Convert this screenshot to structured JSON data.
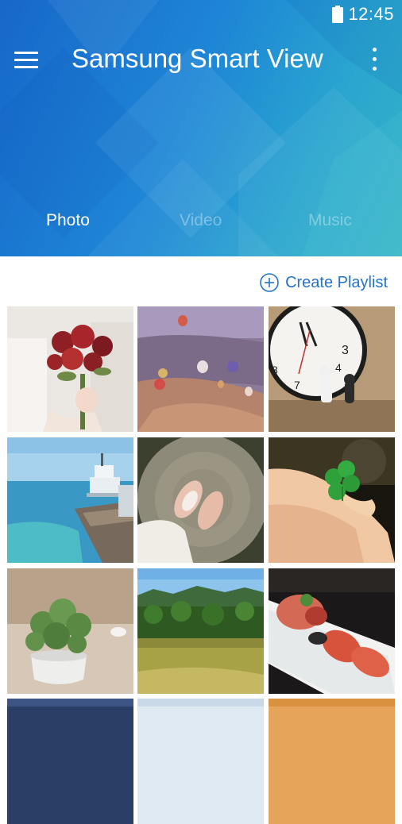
{
  "status_bar": {
    "time": "12:45",
    "battery_icon": "battery-icon"
  },
  "header": {
    "title": "Samsung Smart View",
    "menu_icon": "hamburger-menu-icon",
    "more_icon": "more-vert-icon"
  },
  "tabs": [
    {
      "label": "Photo",
      "selected": true
    },
    {
      "label": "Video",
      "selected": false
    },
    {
      "label": "Music",
      "selected": false
    }
  ],
  "actions": {
    "create_playlist": "Create Playlist",
    "icon": "add-circle-icon"
  },
  "colors": {
    "header_start": "#1767c9",
    "header_end": "#35b3c6",
    "accent": "#2573c9"
  },
  "photos": [
    "photo-red-roses-bouquet",
    "photo-hot-air-balloons-valley",
    "photo-wall-clock-figurines",
    "photo-seaside-lighthouse",
    "photo-shoes-on-wood-stump",
    "photo-hand-holding-clover",
    "photo-potted-succulent",
    "photo-green-field-trees",
    "photo-sushi-plate",
    "photo-night-sky",
    "photo-clouds",
    "photo-sunset"
  ]
}
